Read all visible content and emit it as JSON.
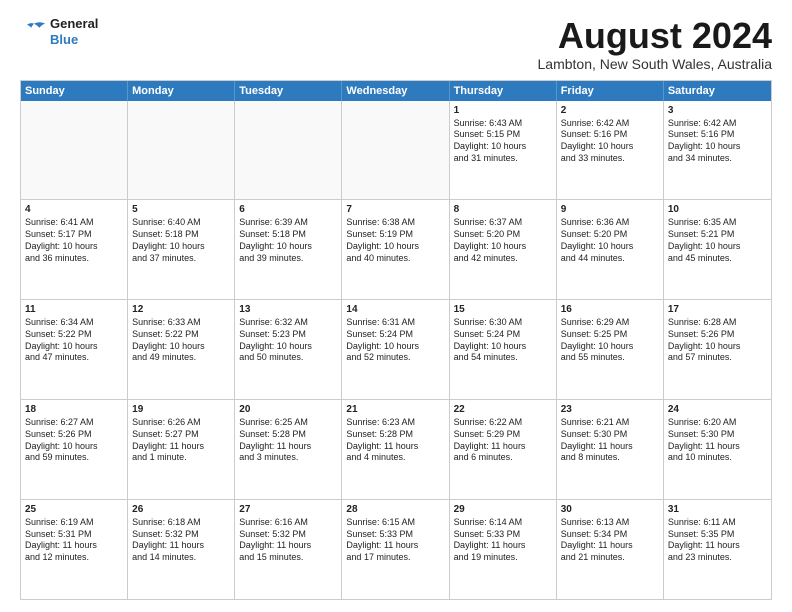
{
  "header": {
    "logo_general": "General",
    "logo_blue": "Blue",
    "month_title": "August 2024",
    "location": "Lambton, New South Wales, Australia"
  },
  "calendar": {
    "days_of_week": [
      "Sunday",
      "Monday",
      "Tuesday",
      "Wednesday",
      "Thursday",
      "Friday",
      "Saturday"
    ],
    "rows": [
      [
        {
          "day": "",
          "empty": true,
          "lines": []
        },
        {
          "day": "",
          "empty": true,
          "lines": []
        },
        {
          "day": "",
          "empty": true,
          "lines": []
        },
        {
          "day": "",
          "empty": true,
          "lines": []
        },
        {
          "day": "1",
          "empty": false,
          "lines": [
            "Sunrise: 6:43 AM",
            "Sunset: 5:15 PM",
            "Daylight: 10 hours",
            "and 31 minutes."
          ]
        },
        {
          "day": "2",
          "empty": false,
          "lines": [
            "Sunrise: 6:42 AM",
            "Sunset: 5:16 PM",
            "Daylight: 10 hours",
            "and 33 minutes."
          ]
        },
        {
          "day": "3",
          "empty": false,
          "lines": [
            "Sunrise: 6:42 AM",
            "Sunset: 5:16 PM",
            "Daylight: 10 hours",
            "and 34 minutes."
          ]
        }
      ],
      [
        {
          "day": "4",
          "empty": false,
          "lines": [
            "Sunrise: 6:41 AM",
            "Sunset: 5:17 PM",
            "Daylight: 10 hours",
            "and 36 minutes."
          ]
        },
        {
          "day": "5",
          "empty": false,
          "lines": [
            "Sunrise: 6:40 AM",
            "Sunset: 5:18 PM",
            "Daylight: 10 hours",
            "and 37 minutes."
          ]
        },
        {
          "day": "6",
          "empty": false,
          "lines": [
            "Sunrise: 6:39 AM",
            "Sunset: 5:18 PM",
            "Daylight: 10 hours",
            "and 39 minutes."
          ]
        },
        {
          "day": "7",
          "empty": false,
          "lines": [
            "Sunrise: 6:38 AM",
            "Sunset: 5:19 PM",
            "Daylight: 10 hours",
            "and 40 minutes."
          ]
        },
        {
          "day": "8",
          "empty": false,
          "lines": [
            "Sunrise: 6:37 AM",
            "Sunset: 5:20 PM",
            "Daylight: 10 hours",
            "and 42 minutes."
          ]
        },
        {
          "day": "9",
          "empty": false,
          "lines": [
            "Sunrise: 6:36 AM",
            "Sunset: 5:20 PM",
            "Daylight: 10 hours",
            "and 44 minutes."
          ]
        },
        {
          "day": "10",
          "empty": false,
          "lines": [
            "Sunrise: 6:35 AM",
            "Sunset: 5:21 PM",
            "Daylight: 10 hours",
            "and 45 minutes."
          ]
        }
      ],
      [
        {
          "day": "11",
          "empty": false,
          "lines": [
            "Sunrise: 6:34 AM",
            "Sunset: 5:22 PM",
            "Daylight: 10 hours",
            "and 47 minutes."
          ]
        },
        {
          "day": "12",
          "empty": false,
          "lines": [
            "Sunrise: 6:33 AM",
            "Sunset: 5:22 PM",
            "Daylight: 10 hours",
            "and 49 minutes."
          ]
        },
        {
          "day": "13",
          "empty": false,
          "lines": [
            "Sunrise: 6:32 AM",
            "Sunset: 5:23 PM",
            "Daylight: 10 hours",
            "and 50 minutes."
          ]
        },
        {
          "day": "14",
          "empty": false,
          "lines": [
            "Sunrise: 6:31 AM",
            "Sunset: 5:24 PM",
            "Daylight: 10 hours",
            "and 52 minutes."
          ]
        },
        {
          "day": "15",
          "empty": false,
          "lines": [
            "Sunrise: 6:30 AM",
            "Sunset: 5:24 PM",
            "Daylight: 10 hours",
            "and 54 minutes."
          ]
        },
        {
          "day": "16",
          "empty": false,
          "lines": [
            "Sunrise: 6:29 AM",
            "Sunset: 5:25 PM",
            "Daylight: 10 hours",
            "and 55 minutes."
          ]
        },
        {
          "day": "17",
          "empty": false,
          "lines": [
            "Sunrise: 6:28 AM",
            "Sunset: 5:26 PM",
            "Daylight: 10 hours",
            "and 57 minutes."
          ]
        }
      ],
      [
        {
          "day": "18",
          "empty": false,
          "lines": [
            "Sunrise: 6:27 AM",
            "Sunset: 5:26 PM",
            "Daylight: 10 hours",
            "and 59 minutes."
          ]
        },
        {
          "day": "19",
          "empty": false,
          "lines": [
            "Sunrise: 6:26 AM",
            "Sunset: 5:27 PM",
            "Daylight: 11 hours",
            "and 1 minute."
          ]
        },
        {
          "day": "20",
          "empty": false,
          "lines": [
            "Sunrise: 6:25 AM",
            "Sunset: 5:28 PM",
            "Daylight: 11 hours",
            "and 3 minutes."
          ]
        },
        {
          "day": "21",
          "empty": false,
          "lines": [
            "Sunrise: 6:23 AM",
            "Sunset: 5:28 PM",
            "Daylight: 11 hours",
            "and 4 minutes."
          ]
        },
        {
          "day": "22",
          "empty": false,
          "lines": [
            "Sunrise: 6:22 AM",
            "Sunset: 5:29 PM",
            "Daylight: 11 hours",
            "and 6 minutes."
          ]
        },
        {
          "day": "23",
          "empty": false,
          "lines": [
            "Sunrise: 6:21 AM",
            "Sunset: 5:30 PM",
            "Daylight: 11 hours",
            "and 8 minutes."
          ]
        },
        {
          "day": "24",
          "empty": false,
          "lines": [
            "Sunrise: 6:20 AM",
            "Sunset: 5:30 PM",
            "Daylight: 11 hours",
            "and 10 minutes."
          ]
        }
      ],
      [
        {
          "day": "25",
          "empty": false,
          "lines": [
            "Sunrise: 6:19 AM",
            "Sunset: 5:31 PM",
            "Daylight: 11 hours",
            "and 12 minutes."
          ]
        },
        {
          "day": "26",
          "empty": false,
          "lines": [
            "Sunrise: 6:18 AM",
            "Sunset: 5:32 PM",
            "Daylight: 11 hours",
            "and 14 minutes."
          ]
        },
        {
          "day": "27",
          "empty": false,
          "lines": [
            "Sunrise: 6:16 AM",
            "Sunset: 5:32 PM",
            "Daylight: 11 hours",
            "and 15 minutes."
          ]
        },
        {
          "day": "28",
          "empty": false,
          "lines": [
            "Sunrise: 6:15 AM",
            "Sunset: 5:33 PM",
            "Daylight: 11 hours",
            "and 17 minutes."
          ]
        },
        {
          "day": "29",
          "empty": false,
          "lines": [
            "Sunrise: 6:14 AM",
            "Sunset: 5:33 PM",
            "Daylight: 11 hours",
            "and 19 minutes."
          ]
        },
        {
          "day": "30",
          "empty": false,
          "lines": [
            "Sunrise: 6:13 AM",
            "Sunset: 5:34 PM",
            "Daylight: 11 hours",
            "and 21 minutes."
          ]
        },
        {
          "day": "31",
          "empty": false,
          "lines": [
            "Sunrise: 6:11 AM",
            "Sunset: 5:35 PM",
            "Daylight: 11 hours",
            "and 23 minutes."
          ]
        }
      ]
    ]
  }
}
